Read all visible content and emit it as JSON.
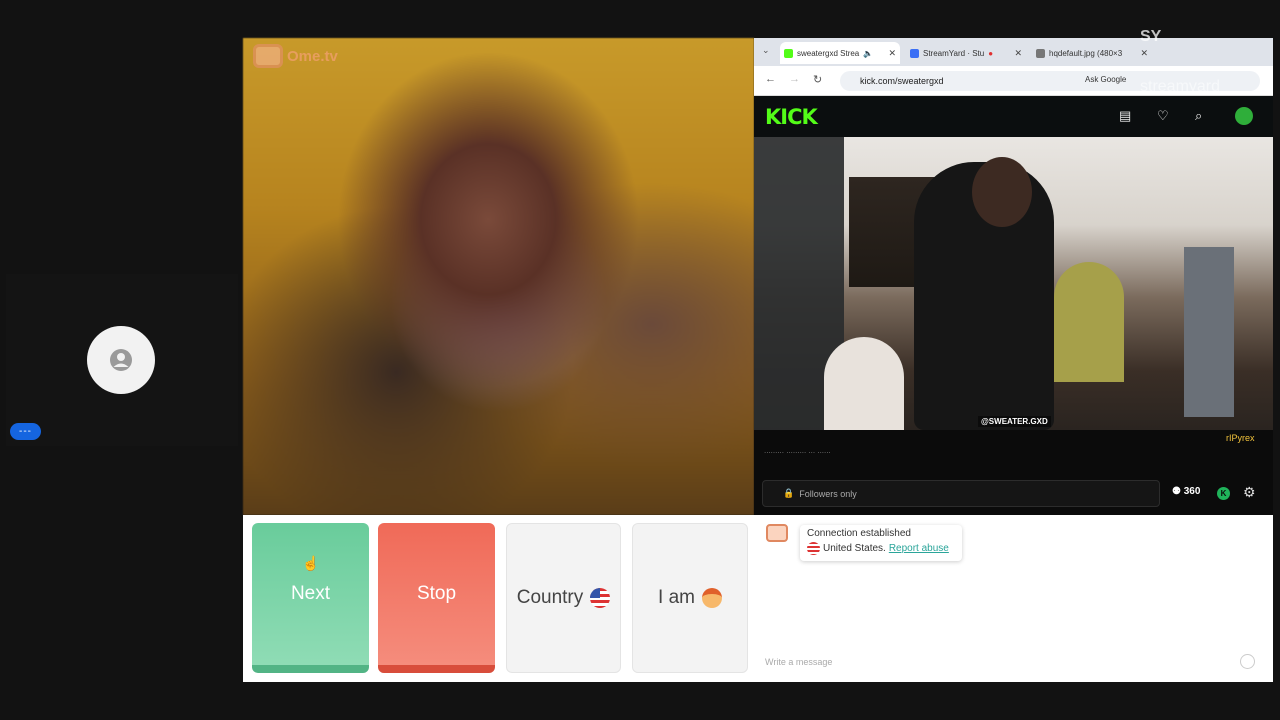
{
  "participant": {
    "name_label": "---"
  },
  "ome": {
    "logo_text": "Ome.tv",
    "buttons": {
      "next": "Next",
      "stop": "Stop",
      "country": "Country",
      "i_am": "I am"
    },
    "chat": {
      "status": "Connection established",
      "country_text": "United States.",
      "report_link": "Report abuse",
      "input_placeholder": "Write a message"
    }
  },
  "browser": {
    "tabs": [
      {
        "label": "sweatergxd Strea",
        "icon": "kick-favicon",
        "color": "#53fc18"
      },
      {
        "label": "StreamYard · Stu",
        "icon": "streamyard-favicon",
        "color": "#3b6ff5"
      },
      {
        "label": "hqdefault.jpg (480×3",
        "icon": "globe-favicon",
        "color": "#777777"
      }
    ],
    "url": "kick.com/sweatergxd",
    "ask_google": "Ask Google"
  },
  "kick": {
    "logo": "KICK",
    "stream_tag": "@SWEATER.GXD",
    "viewer_name": "rIPyrex",
    "chat_line": "......... ......... ... ......",
    "followers_only": "Followers only",
    "viewer_count": "360",
    "badge": "K"
  },
  "overlay": {
    "logo": "SY",
    "text": "streamyard"
  },
  "colors": {
    "next": "#69cc9b",
    "stop": "#f06a58",
    "kick_green": "#53fc18",
    "pill_blue": "#1565e0"
  }
}
